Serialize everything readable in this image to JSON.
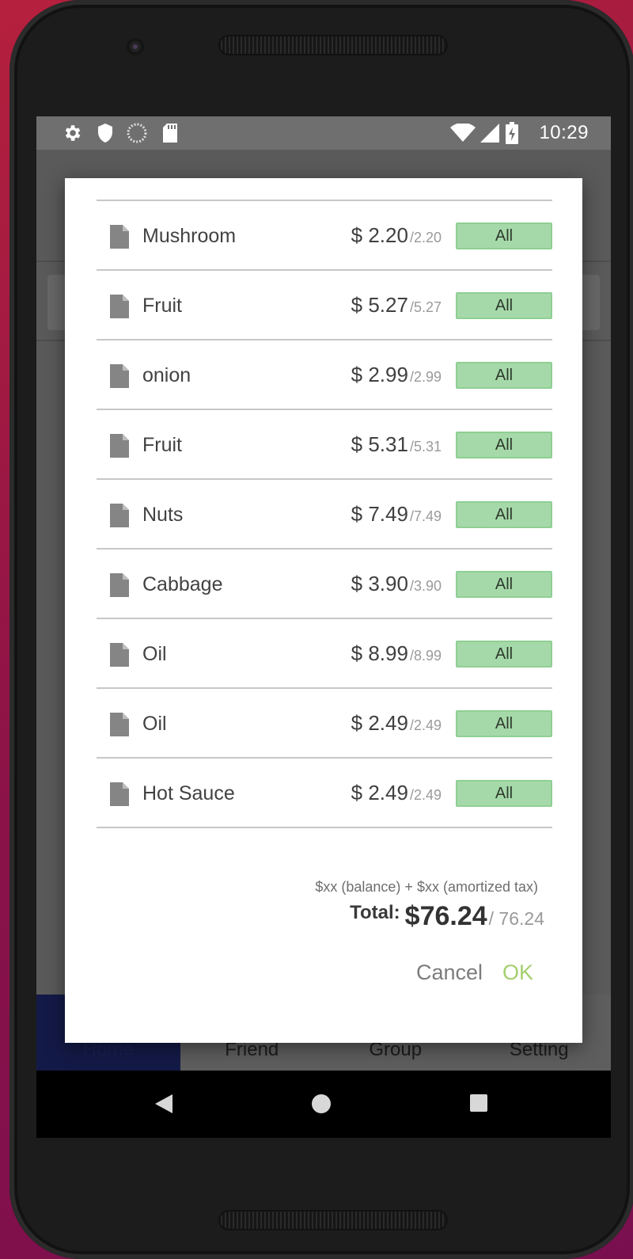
{
  "status_bar": {
    "time": "10:29",
    "icons": [
      "gear-icon",
      "shield-icon",
      "sync-icon",
      "sd-card-icon",
      "wifi-icon",
      "signal-icon",
      "battery-icon"
    ]
  },
  "bottom_nav": {
    "items": [
      {
        "label": "Home",
        "active": true
      },
      {
        "label": "Friend",
        "active": false
      },
      {
        "label": "Group",
        "active": false
      },
      {
        "label": "Setting",
        "active": false
      }
    ]
  },
  "dialog": {
    "items": [
      {
        "name": "Mushroom",
        "price": "$ 2.20",
        "sub": "/2.20",
        "button": "All"
      },
      {
        "name": "Fruit",
        "price": "$ 5.27",
        "sub": "/5.27",
        "button": "All"
      },
      {
        "name": "onion",
        "price": "$ 2.99",
        "sub": "/2.99",
        "button": "All"
      },
      {
        "name": "Fruit",
        "price": "$ 5.31",
        "sub": "/5.31",
        "button": "All"
      },
      {
        "name": "Nuts",
        "price": "$ 7.49",
        "sub": "/7.49",
        "button": "All"
      },
      {
        "name": "Cabbage",
        "price": "$ 3.90",
        "sub": "/3.90",
        "button": "All"
      },
      {
        "name": "Oil",
        "price": "$ 8.99",
        "sub": "/8.99",
        "button": "All"
      },
      {
        "name": "Oil",
        "price": "$ 2.49",
        "sub": "/2.49",
        "button": "All"
      },
      {
        "name": "Hot Sauce",
        "price": "$ 2.49",
        "sub": "/2.49",
        "button": "All"
      }
    ],
    "tax_note": "$xx (balance) + $xx (amortized tax)",
    "total_label": "Total:",
    "total_value": "$76.24",
    "total_sub": "/ 76.24",
    "cancel_label": "Cancel",
    "ok_label": "OK"
  },
  "colors": {
    "all_button_bg": "#a6d9a9",
    "ok_text": "#a4cf6e",
    "nav_active": "#141a47"
  }
}
